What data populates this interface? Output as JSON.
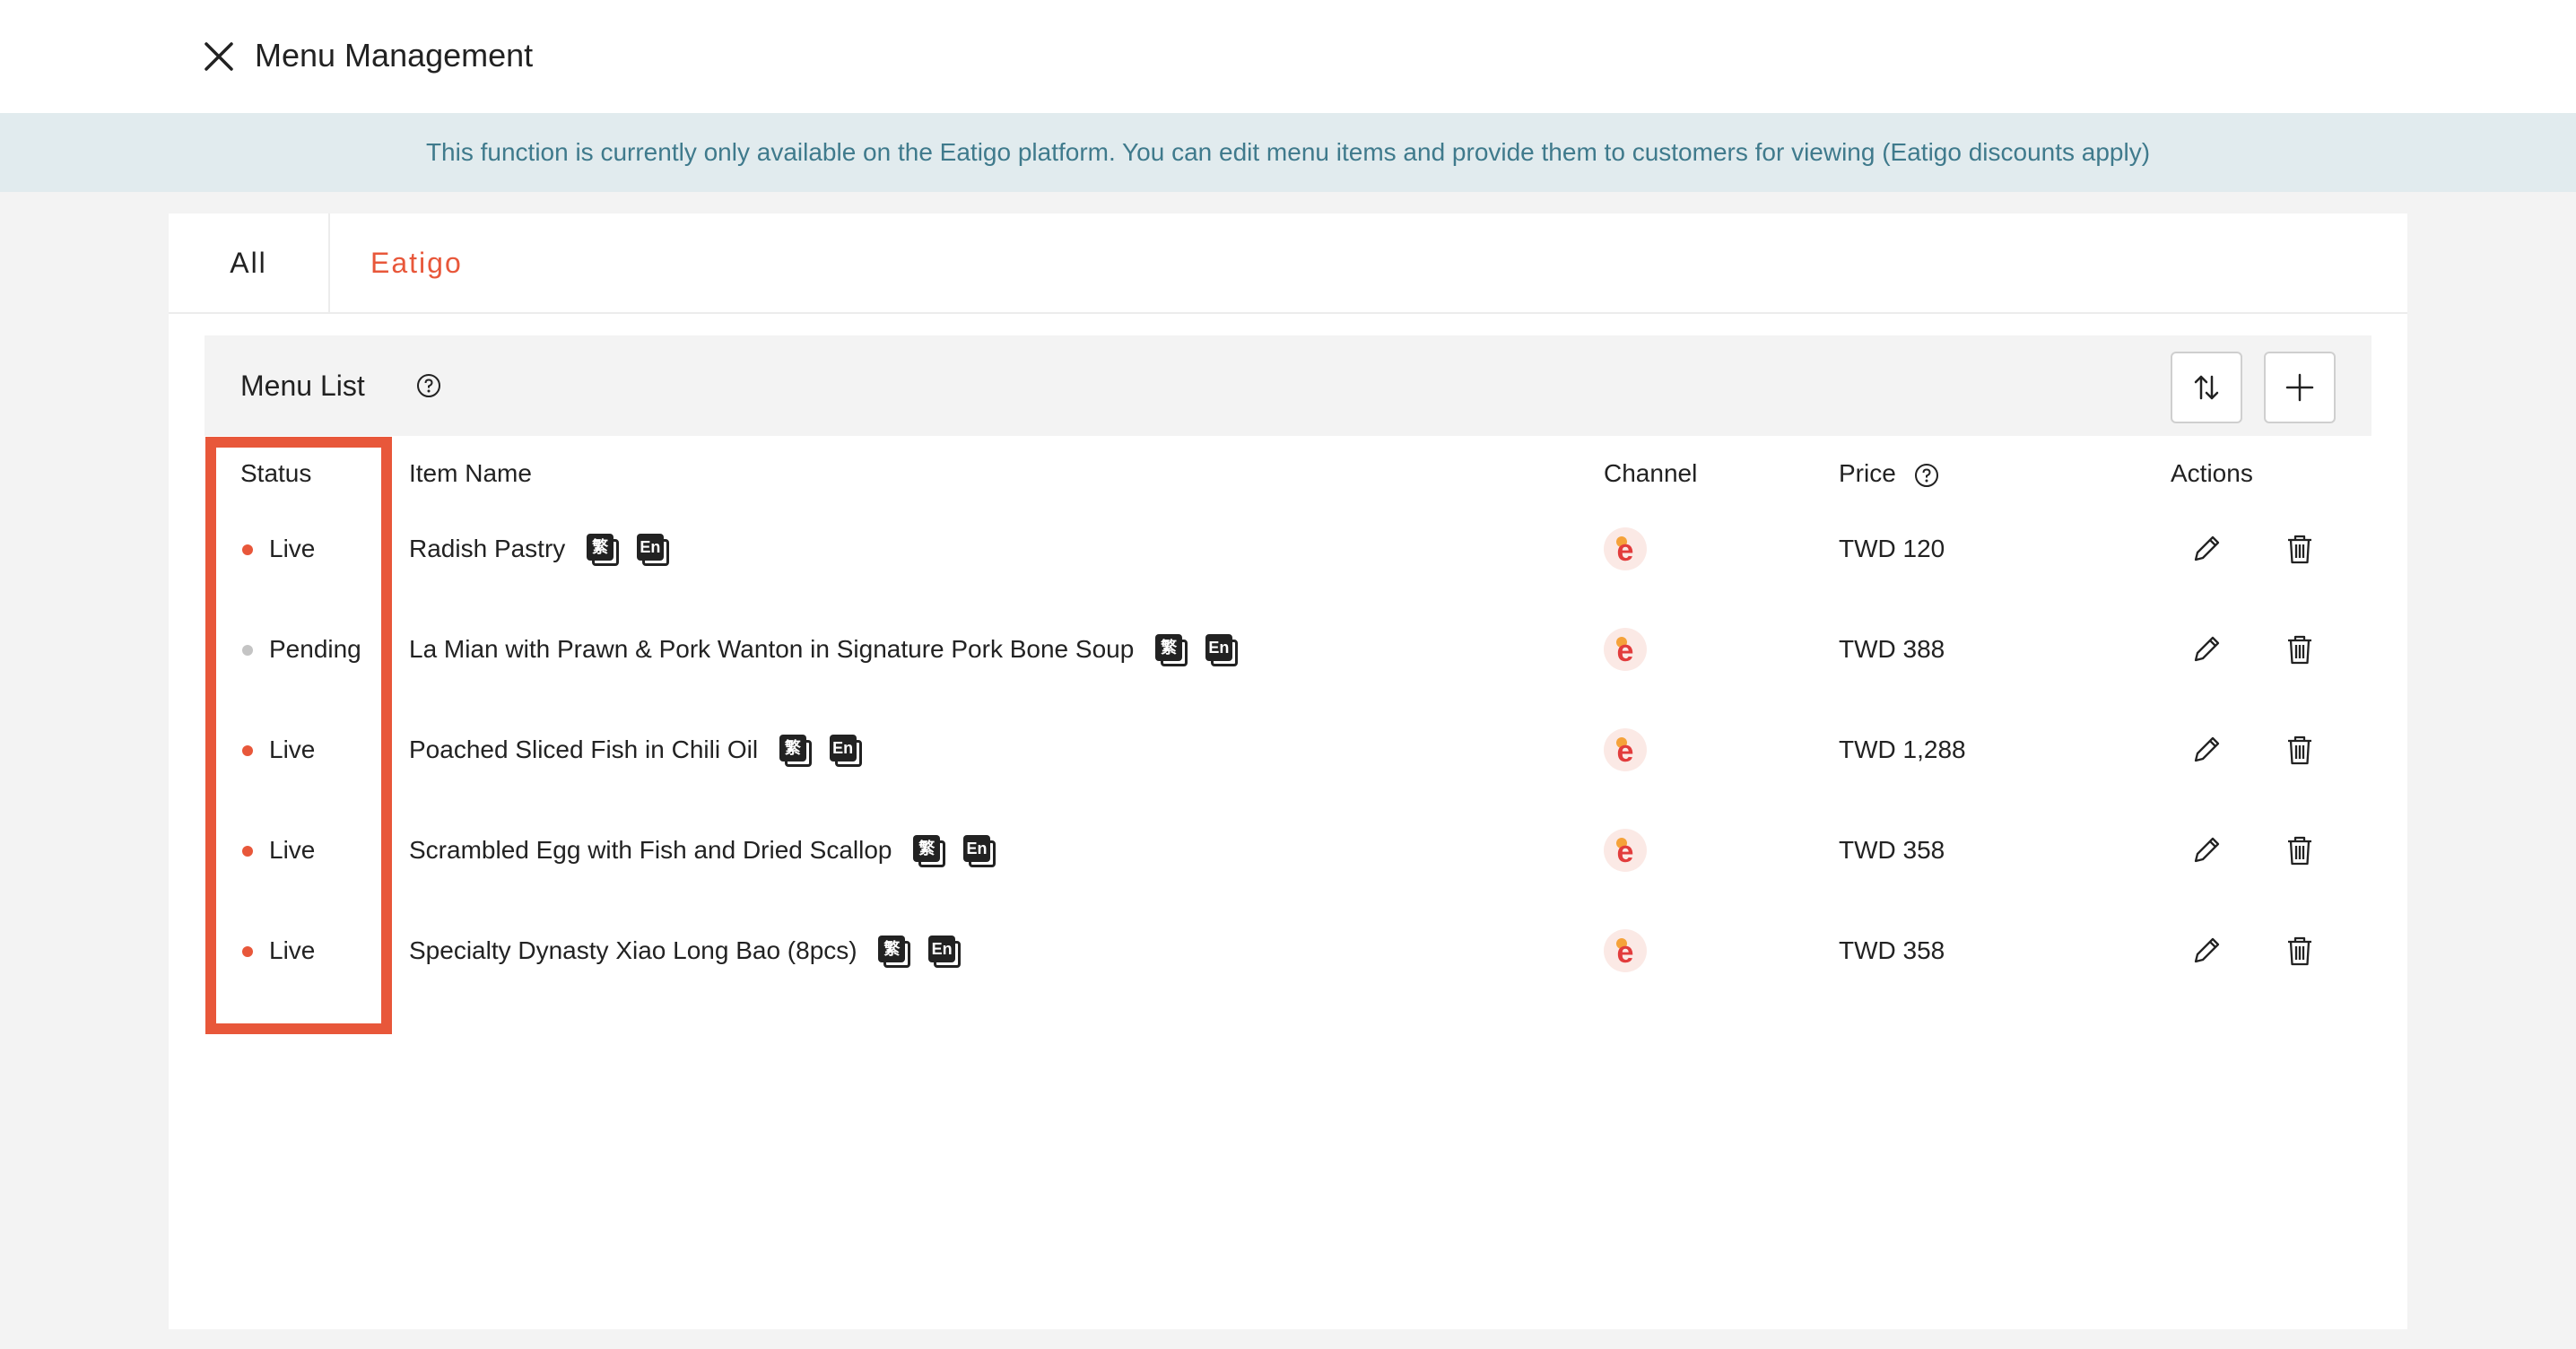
{
  "header": {
    "title": "Menu Management",
    "close_icon": "close-icon"
  },
  "notice": {
    "text": "This function is currently only available on the Eatigo platform. You can edit menu items and provide them to customers for viewing (Eatigo discounts apply)"
  },
  "tabs": [
    {
      "label": "All",
      "active": false
    },
    {
      "label": "Eatigo",
      "active": true
    }
  ],
  "menu_list": {
    "title": "Menu List",
    "buttons": {
      "sort_icon": "sort-icon",
      "add_icon": "plus-icon"
    }
  },
  "table": {
    "headers": {
      "status": "Status",
      "item_name": "Item Name",
      "channel": "Channel",
      "price": "Price",
      "actions": "Actions"
    },
    "rows": [
      {
        "status": "Live",
        "status_color": "#e8573a",
        "name": "Radish Pastry",
        "lang_zh": "繁",
        "lang_en": "En",
        "channel": "e",
        "price": "TWD 120"
      },
      {
        "status": "Pending",
        "status_color": "#c4c4c4",
        "name": "La Mian with Prawn & Pork Wanton in Signature Pork Bone Soup",
        "lang_zh": "繁",
        "lang_en": "En",
        "channel": "e",
        "price": "TWD 388"
      },
      {
        "status": "Live",
        "status_color": "#e8573a",
        "name": "Poached Sliced Fish in Chili Oil",
        "lang_zh": "繁",
        "lang_en": "En",
        "channel": "e",
        "price": "TWD 1,288"
      },
      {
        "status": "Live",
        "status_color": "#e8573a",
        "name": "Scrambled Egg with Fish and Dried Scallop",
        "lang_zh": "繁",
        "lang_en": "En",
        "channel": "e",
        "price": "TWD 358"
      },
      {
        "status": "Live",
        "status_color": "#e8573a",
        "name": "Specialty Dynasty Xiao Long Bao (8pcs)",
        "lang_zh": "繁",
        "lang_en": "En",
        "channel": "e",
        "price": "TWD 358"
      }
    ]
  },
  "colors": {
    "accent": "#e8573a",
    "notice_bg": "#e1ebee",
    "notice_text": "#3f7a8c"
  }
}
